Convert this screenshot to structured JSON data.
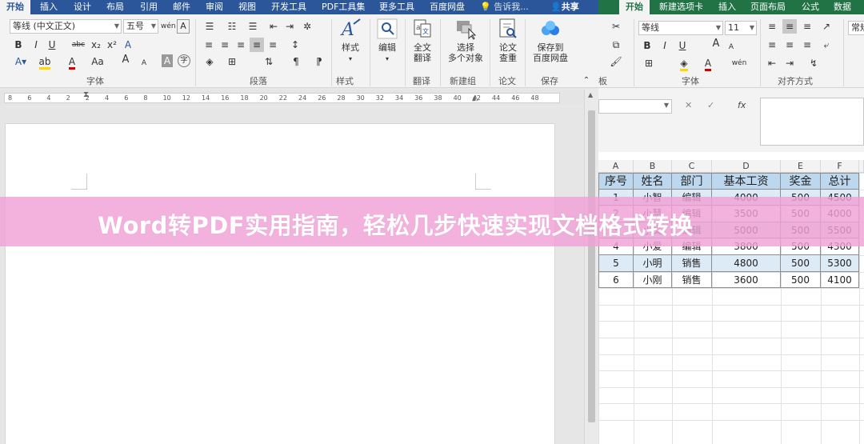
{
  "colors": {
    "word_blue": "#2b579a",
    "excel_green": "#217346",
    "banner_pink": "#f0a0d6",
    "table_header": "#bdd7ee",
    "table_alt": "#ddebf7"
  },
  "word": {
    "tabs": [
      "开始",
      "插入",
      "设计",
      "布局",
      "引用",
      "邮件",
      "审阅",
      "视图",
      "开发工具",
      "PDF工具集",
      "更多工具",
      "百度网盘"
    ],
    "tell_me": "告诉我...",
    "share": "共享",
    "font_name": "等线 (中文正文)",
    "font_size": "五号",
    "font_buttons": {
      "wen": "wén",
      "bold": "B",
      "italic": "I",
      "underline": "U",
      "strike": "abc",
      "sub": "x₂",
      "sup": "x²",
      "font_color": "A",
      "aa": "Aa",
      "grow": "A",
      "shrink": "A",
      "clear": "A"
    },
    "groups": {
      "font": "字体",
      "paragraph": "段落",
      "style_group": "样式",
      "translate": "翻译",
      "new_group": "新建组",
      "paper": "论文",
      "save": "保存"
    },
    "big_buttons": {
      "style": "样式",
      "edit": "编辑",
      "full_translate": [
        "全文",
        "翻译"
      ],
      "select_objects": [
        "选择",
        "多个对象"
      ],
      "paper_check": [
        "论文",
        "查重"
      ],
      "save_baidu": [
        "保存到",
        "百度网盘"
      ]
    },
    "ruler_numbers": [
      "8",
      "6",
      "4",
      "2",
      "2",
      "4",
      "6",
      "8",
      "10",
      "12",
      "14",
      "16",
      "18",
      "20",
      "22",
      "24",
      "26",
      "28",
      "30",
      "32",
      "34",
      "36",
      "38",
      "40",
      "42",
      "44",
      "46",
      "48"
    ]
  },
  "excel": {
    "tabs": [
      "开始",
      "新建选项卡",
      "插入",
      "页面布局",
      "公式",
      "数据"
    ],
    "font_name": "等线",
    "font_size": "11",
    "font_buttons": {
      "bold": "B",
      "italic": "I",
      "underline": "U",
      "grow": "A",
      "shrink": "A",
      "font_color": "A",
      "wen": "wén"
    },
    "groups": {
      "clipboard_partial": "板",
      "font": "字体",
      "alignment": "对齐方式"
    },
    "right_partial": "常规",
    "fx": "fx",
    "cancel": "✕",
    "confirm": "✓",
    "columns": [
      "A",
      "B",
      "C",
      "D",
      "E",
      "F"
    ],
    "table": {
      "headers": [
        "序号",
        "姓名",
        "部门",
        "基本工资",
        "奖金",
        "总计"
      ],
      "rows": [
        [
          "1",
          "小智",
          "编辑",
          "4000",
          "500",
          "4500"
        ],
        [
          "2",
          "小慧",
          "编辑",
          "3500",
          "500",
          "4000"
        ],
        [
          "3",
          "小文",
          "编辑",
          "5000",
          "500",
          "5500"
        ],
        [
          "4",
          "小爱",
          "编辑",
          "3800",
          "500",
          "4300"
        ],
        [
          "5",
          "小明",
          "销售",
          "4800",
          "500",
          "5300"
        ],
        [
          "6",
          "小刚",
          "销售",
          "3600",
          "500",
          "4100"
        ]
      ]
    }
  },
  "banner": {
    "title": "Word转PDF实用指南，轻松几步快速实现文档格式转换"
  }
}
